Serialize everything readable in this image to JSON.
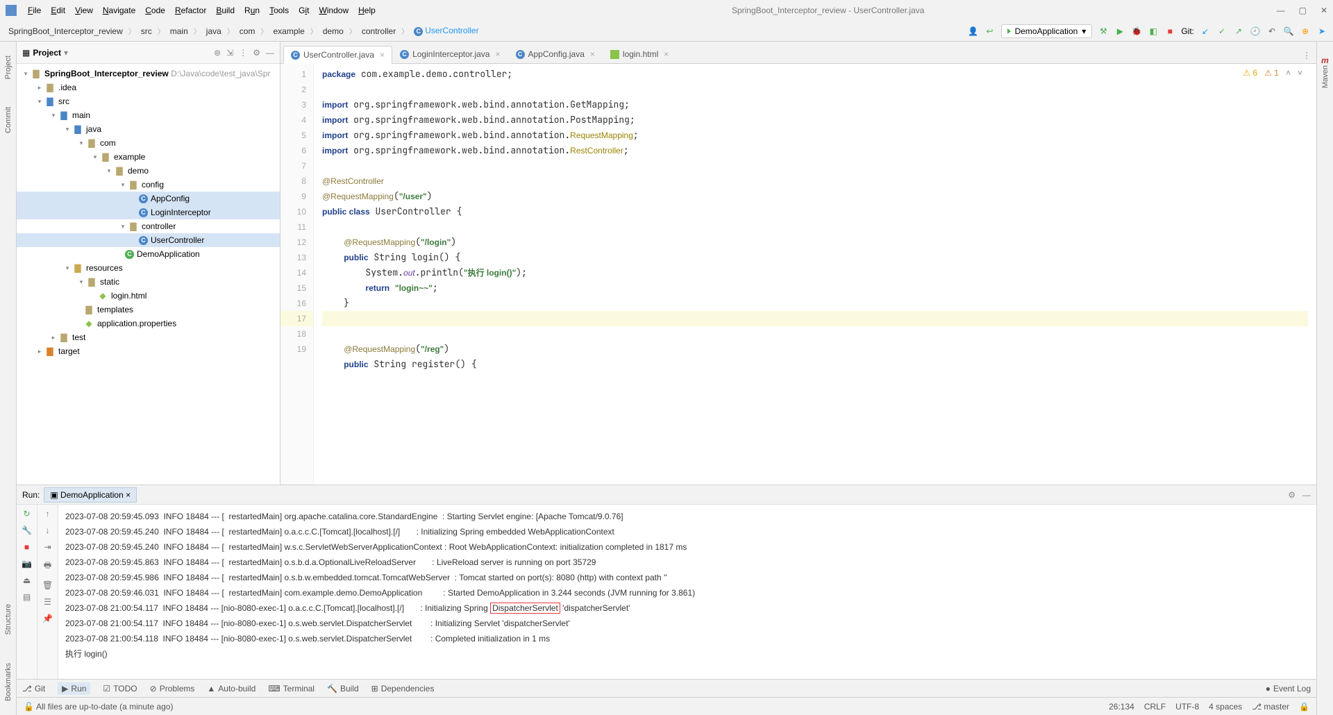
{
  "title": "SpringBoot_Interceptor_review - UserController.java",
  "menu": [
    "File",
    "Edit",
    "View",
    "Navigate",
    "Code",
    "Refactor",
    "Build",
    "Run",
    "Tools",
    "Git",
    "Window",
    "Help"
  ],
  "crumbs": [
    "SpringBoot_Interceptor_review",
    "src",
    "main",
    "java",
    "com",
    "example",
    "demo",
    "controller",
    "UserController"
  ],
  "runConfig": "DemoApplication",
  "gitLabel": "Git:",
  "proj": {
    "title": "Project",
    "root": "SpringBoot_Interceptor_review",
    "rootPath": "D:\\Java\\code\\test_java\\Spr",
    "nodes": [
      ".idea",
      "src",
      "main",
      "java",
      "com",
      "example",
      "demo",
      "config",
      "AppConfig",
      "LoginInterceptor",
      "controller",
      "UserController",
      "DemoApplication",
      "resources",
      "static",
      "login.html",
      "templates",
      "application.properties",
      "test",
      "target"
    ]
  },
  "tabs": [
    {
      "label": "UserController.java",
      "type": "c",
      "active": true
    },
    {
      "label": "LoginInterceptor.java",
      "type": "c"
    },
    {
      "label": "AppConfig.java",
      "type": "c"
    },
    {
      "label": "login.html",
      "type": "h"
    }
  ],
  "warnings": {
    "yellow": "6",
    "orange": "1"
  },
  "codeLines": 19,
  "run": {
    "label": "Run:",
    "tab": "DemoApplication",
    "lines": [
      "2023-07-08 20:59:45.093  INFO 18484 --- [  restartedMain] org.apache.catalina.core.StandardEngine  : Starting Servlet engine: [Apache Tomcat/9.0.76]",
      "2023-07-08 20:59:45.240  INFO 18484 --- [  restartedMain] o.a.c.c.C.[Tomcat].[localhost].[/]       : Initializing Spring embedded WebApplicationContext",
      "2023-07-08 20:59:45.240  INFO 18484 --- [  restartedMain] w.s.c.ServletWebServerApplicationContext : Root WebApplicationContext: initialization completed in 1817 ms",
      "2023-07-08 20:59:45.863  INFO 18484 --- [  restartedMain] o.s.b.d.a.OptionalLiveReloadServer       : LiveReload server is running on port 35729",
      "2023-07-08 20:59:45.986  INFO 18484 --- [  restartedMain] o.s.b.w.embedded.tomcat.TomcatWebServer  : Tomcat started on port(s): 8080 (http) with context path ''",
      "2023-07-08 20:59:46.031  INFO 18484 --- [  restartedMain] com.example.demo.DemoApplication         : Started DemoApplication in 3.244 seconds (JVM running for 3.861)",
      "2023-07-08 21:00:54.117  INFO 18484 --- [nio-8080-exec-1] o.a.c.c.C.[Tomcat].[localhost].[/]       : Initializing Spring |DispatcherServlet| 'dispatcherServlet'",
      "2023-07-08 21:00:54.117  INFO 18484 --- [nio-8080-exec-1] o.s.web.servlet.DispatcherServlet        : Initializing Servlet 'dispatcherServlet'",
      "2023-07-08 21:00:54.118  INFO 18484 --- [nio-8080-exec-1] o.s.web.servlet.DispatcherServlet        : Completed initialization in 1 ms",
      "执行 login()"
    ]
  },
  "toolstrip": [
    "Git",
    "Run",
    "TODO",
    "Problems",
    "Auto-build",
    "Terminal",
    "Build",
    "Dependencies"
  ],
  "eventLog": "Event Log",
  "status": {
    "msg": "All files are up-to-date (a minute ago)",
    "pos": "26:134",
    "crlf": "CRLF",
    "enc": "UTF-8",
    "indent": "4 spaces",
    "branch": "master"
  },
  "leftTabs": [
    "Commit",
    "Project"
  ],
  "leftTabs2": [
    "Bookmarks",
    "Structure"
  ],
  "rightTab": "Maven"
}
